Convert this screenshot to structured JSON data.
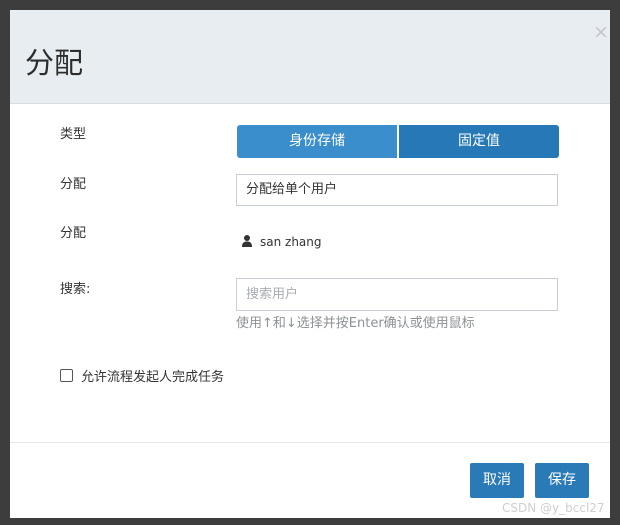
{
  "dialog": {
    "title": "分配",
    "close_glyph": "×"
  },
  "form": {
    "type_label": "类型",
    "type_options": [
      "身份存储",
      "固定值"
    ],
    "assign_label_1": "分配",
    "assign_select_value": "分配给单个用户",
    "assign_label_2": "分配",
    "assigned_user": "san zhang",
    "search_label": "搜索:",
    "search_placeholder": "搜索用户",
    "search_value": "",
    "help_text": "使用↑和↓选择并按Enter确认或使用鼠标",
    "checkbox_label": "允许流程发起人完成任务",
    "checkbox_checked": false
  },
  "footer": {
    "cancel_label": "取消",
    "save_label": "保存"
  },
  "watermark": "CSDN @y_bccl27",
  "colors": {
    "primary_button": "#2a7ab8",
    "toggle_active": "#3b8ecc",
    "header_bg": "#e8edf1"
  }
}
